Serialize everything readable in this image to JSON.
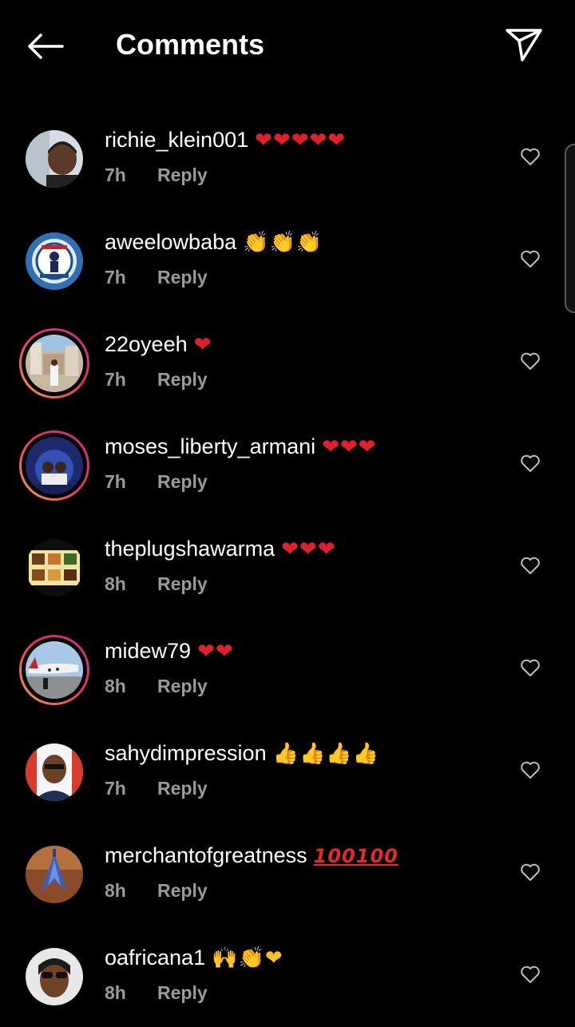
{
  "header": {
    "title": "Comments",
    "back_icon": "arrow-left-icon",
    "share_icon": "paper-plane-icon"
  },
  "colors": {
    "background": "#000000",
    "text": "#ffffff",
    "meta": "#9a9a9a",
    "heart": "#e0202f",
    "story_ring_start": "#f9a03c",
    "story_ring_end": "#c13584"
  },
  "comments": [
    {
      "username": "richie_klein001",
      "emoji": "❤❤❤❤❤",
      "emoji_type": "hearts",
      "time": "7h",
      "reply": "Reply",
      "story_ring": false
    },
    {
      "username": "aweelowbaba",
      "emoji": "👏👏👏",
      "emoji_type": "yellow",
      "time": "7h",
      "reply": "Reply",
      "story_ring": false
    },
    {
      "username": "22oyeeh",
      "emoji": "❤",
      "emoji_type": "hearts",
      "time": "7h",
      "reply": "Reply",
      "story_ring": true
    },
    {
      "username": "moses_liberty_armani",
      "emoji": "❤❤❤",
      "emoji_type": "hearts",
      "time": "7h",
      "reply": "Reply",
      "story_ring": true
    },
    {
      "username": "theplugshawarma",
      "emoji": "❤❤❤",
      "emoji_type": "hearts",
      "time": "8h",
      "reply": "Reply",
      "story_ring": false
    },
    {
      "username": "midew79",
      "emoji": "❤❤",
      "emoji_type": "hearts",
      "time": "8h",
      "reply": "Reply",
      "story_ring": true
    },
    {
      "username": "sahydimpression",
      "emoji": "👍👍👍👍",
      "emoji_type": "yellow",
      "time": "7h",
      "reply": "Reply",
      "story_ring": false
    },
    {
      "username": "merchantofgreatness",
      "emoji": "100100",
      "emoji_type": "hundred",
      "time": "8h",
      "reply": "Reply",
      "story_ring": false
    },
    {
      "username": "oafricana1",
      "emoji": "🙌👏❤",
      "emoji_type": "mixed",
      "time": "8h",
      "reply": "Reply",
      "story_ring": false
    }
  ]
}
